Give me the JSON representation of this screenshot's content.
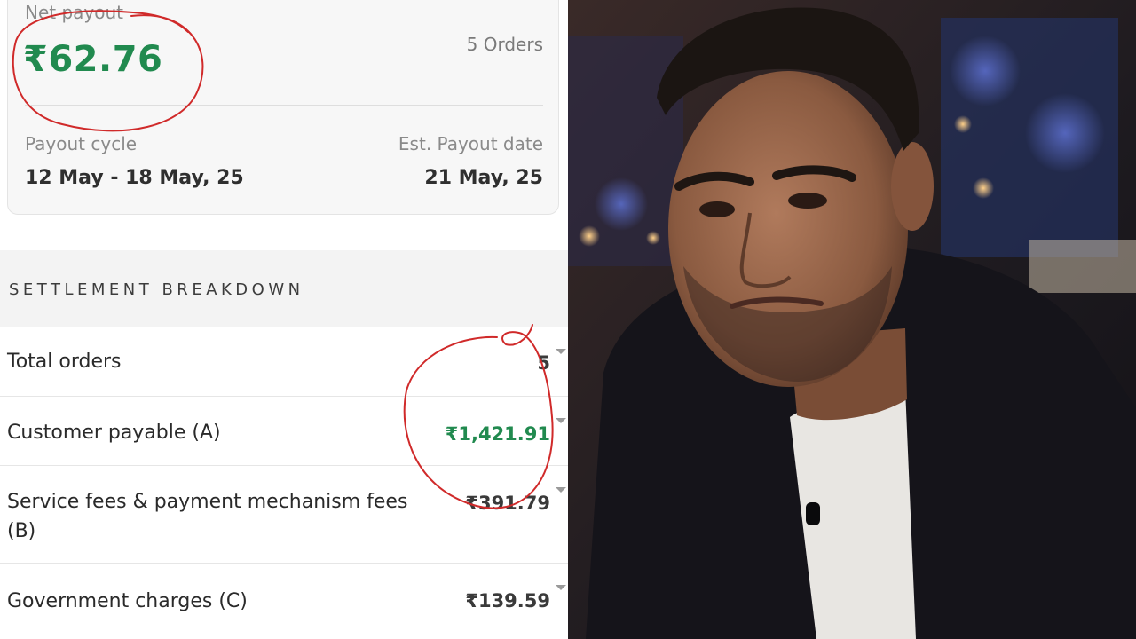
{
  "payout_card": {
    "net_payout_label": "Net payout",
    "net_payout_amount": "₹62.76",
    "orders_count": "5 Orders",
    "payout_cycle_label": "Payout cycle",
    "payout_cycle_value": "12 May - 18 May, 25",
    "payout_date_label": "Est. Payout date",
    "payout_date_value": "21 May, 25"
  },
  "settlement": {
    "title": "SETTLEMENT BREAKDOWN",
    "rows": [
      {
        "label": "Total orders",
        "value": "5"
      },
      {
        "label": "Customer payable (A)",
        "value": "₹1,421.91"
      },
      {
        "label": "Service fees & payment mechanism fees (B)",
        "value": "₹391.79"
      },
      {
        "label": "Government charges (C)",
        "value": "₹139.59"
      }
    ]
  },
  "colors": {
    "positive_amount": "#218a4f",
    "annotation_ink": "#d02a2a"
  },
  "icons": [
    "expand-caret-icon"
  ]
}
